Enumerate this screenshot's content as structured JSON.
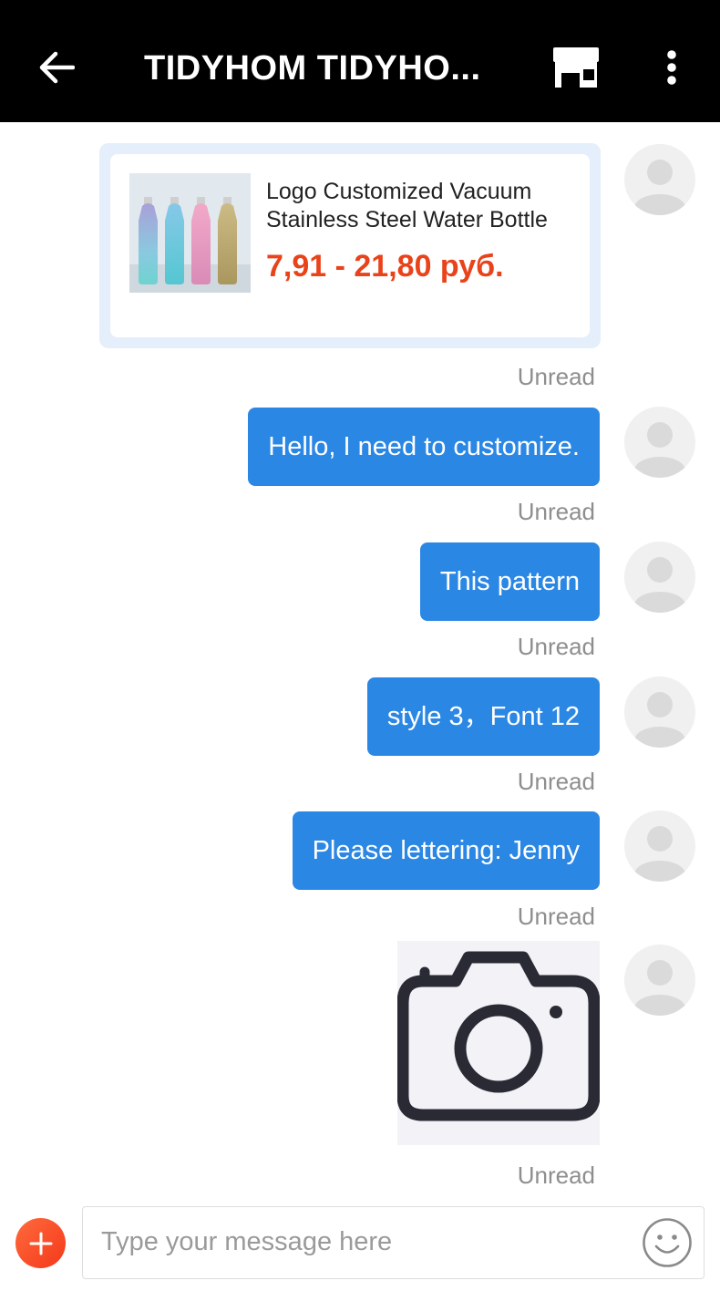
{
  "header": {
    "title": "TIDYHOM TIDYHO...",
    "back_icon": "arrow-left-icon",
    "store_icon": "store-icon",
    "more_icon": "more-vertical-icon"
  },
  "product": {
    "name": "Logo Customized Vacuum Stainless Steel Water Bottle",
    "price": "7,91 - 21,80 руб."
  },
  "messages": [
    {
      "text": "Hello, I need to customize.",
      "status": "Unread"
    },
    {
      "text": "This pattern",
      "status": "Unread"
    },
    {
      "text": "style 3，Font 12",
      "status": "Unread"
    },
    {
      "text": "Please lettering: Jenny",
      "status": "Unread"
    }
  ],
  "product_status": "Unread",
  "image_message": {
    "icon": "camera-icon",
    "status": "Unread"
  },
  "input": {
    "placeholder": "Type your message here",
    "value": "",
    "add_icon": "plus-icon",
    "emoji_icon": "smiley-icon"
  },
  "colors": {
    "header_bg": "#000000",
    "bubble_bg": "#2b87e4",
    "price": "#e8431a",
    "accent": "#f4391a"
  }
}
